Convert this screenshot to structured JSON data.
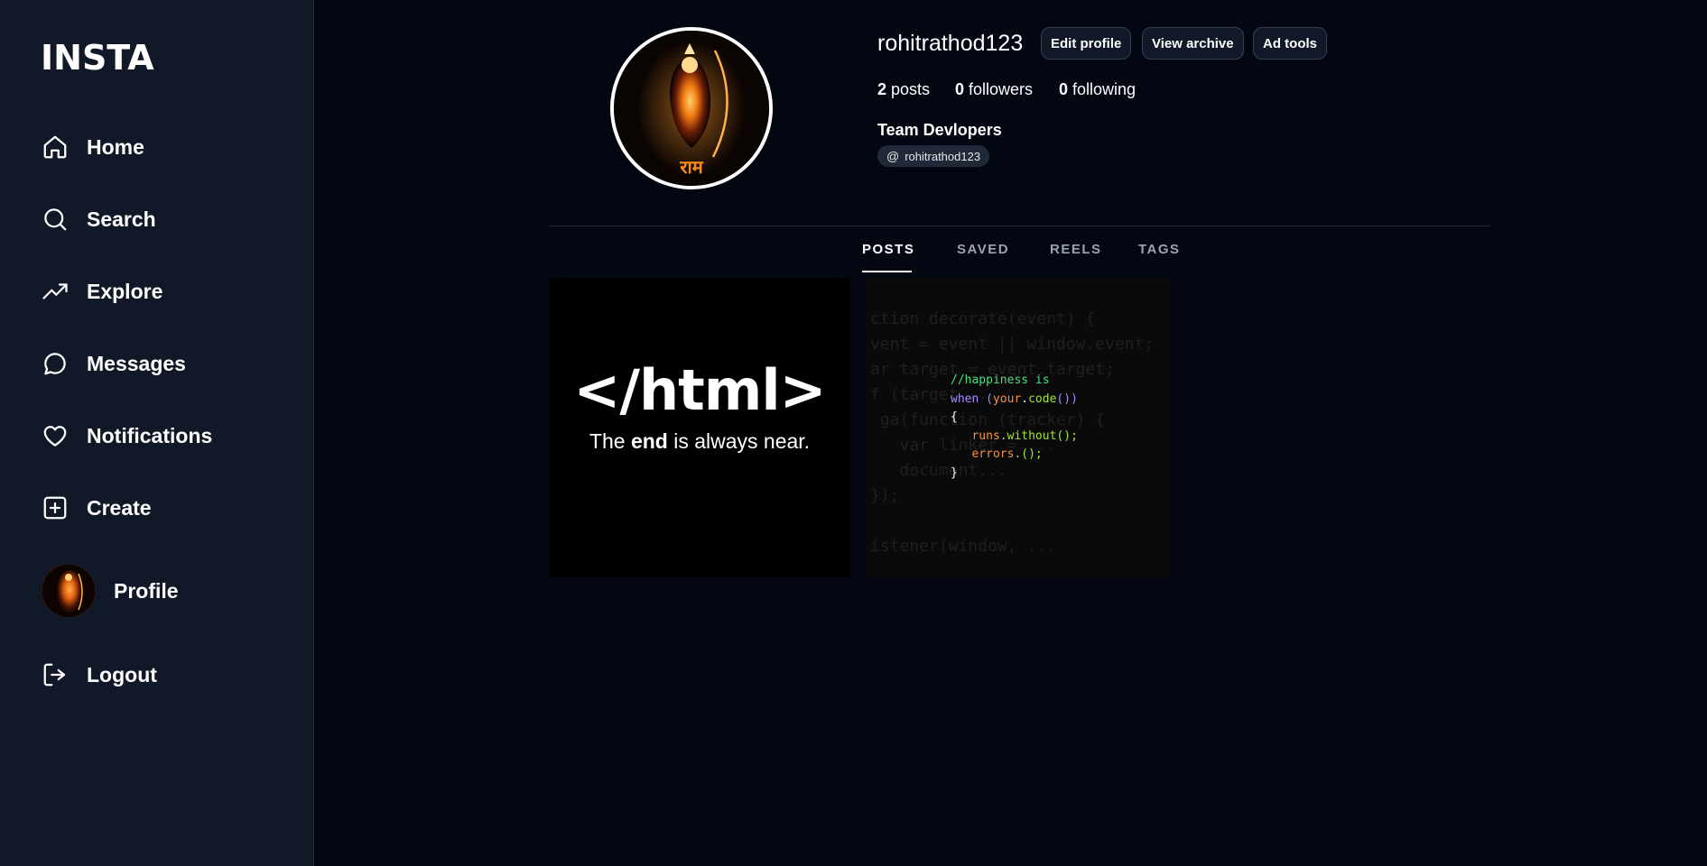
{
  "app": {
    "logo": "INSTA"
  },
  "sidebar": {
    "items": [
      {
        "label": "Home",
        "icon": "home-icon"
      },
      {
        "label": "Search",
        "icon": "search-icon"
      },
      {
        "label": "Explore",
        "icon": "trending-up-icon"
      },
      {
        "label": "Messages",
        "icon": "message-circle-icon"
      },
      {
        "label": "Notifications",
        "icon": "heart-icon"
      },
      {
        "label": "Create",
        "icon": "plus-square-icon"
      },
      {
        "label": "Profile",
        "icon": "avatar"
      },
      {
        "label": "Logout",
        "icon": "logout-icon"
      }
    ]
  },
  "profile": {
    "username": "rohitrathod123",
    "buttons": {
      "edit": "Edit profile",
      "archive": "View archive",
      "ad_tools": "Ad tools"
    },
    "stats": {
      "posts_count": "2",
      "posts_label": "posts",
      "followers_count": "0",
      "followers_label": "followers",
      "following_count": "0",
      "following_label": "following"
    },
    "full_name": "Team Devlopers",
    "handle_chip": {
      "icon": "at-icon",
      "text": "rohitrathod123"
    }
  },
  "tabs": [
    {
      "label": "POSTS",
      "active": true
    },
    {
      "label": "SAVED",
      "active": false
    },
    {
      "label": "REELS",
      "active": false
    },
    {
      "label": "TAGS",
      "active": false
    }
  ],
  "posts": [
    {
      "big_text": "</html>",
      "sub_pre": "The ",
      "sub_bold": "end",
      "sub_post": " is always near."
    },
    {
      "code": {
        "line1": "//happiness is",
        "line2_kw": "when",
        "line2_rest_a": " (",
        "line2_obj": "your",
        "line2_dot": ".",
        "line2_fn": "code",
        "line2_end": "())",
        "line3": "{",
        "line4_obj": "runs",
        "line4_rest": ".without();",
        "line5_obj": "errors",
        "line5_rest": ".();",
        "line6": "}"
      }
    }
  ],
  "colors": {
    "background": "#030712",
    "sidebar": "#111827",
    "accent_white": "#ffffff",
    "muted": "#9ca3af"
  }
}
